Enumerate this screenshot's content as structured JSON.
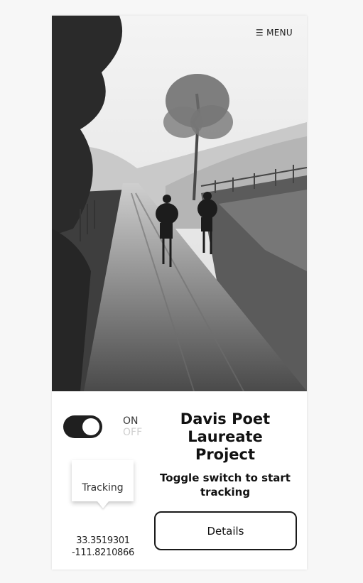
{
  "header": {
    "menu_icon": "hamburger-icon",
    "menu_label": "☰ MENU"
  },
  "hero": {
    "image": "two cyclists riding on a misty dirt road (black and white photo)"
  },
  "tracking": {
    "toggle_state": "on",
    "on_label": "ON",
    "off_label": "OFF",
    "bubble_label": "Tracking",
    "latitude": "33.3519301",
    "longitude": "-111.8210866"
  },
  "project": {
    "title": "Davis Poet Laureate Project",
    "instruction": "Toggle switch to start tracking",
    "details_label": "Details"
  },
  "colors": {
    "accent": "#1f1f1f",
    "off_text": "#cfcfcf"
  }
}
